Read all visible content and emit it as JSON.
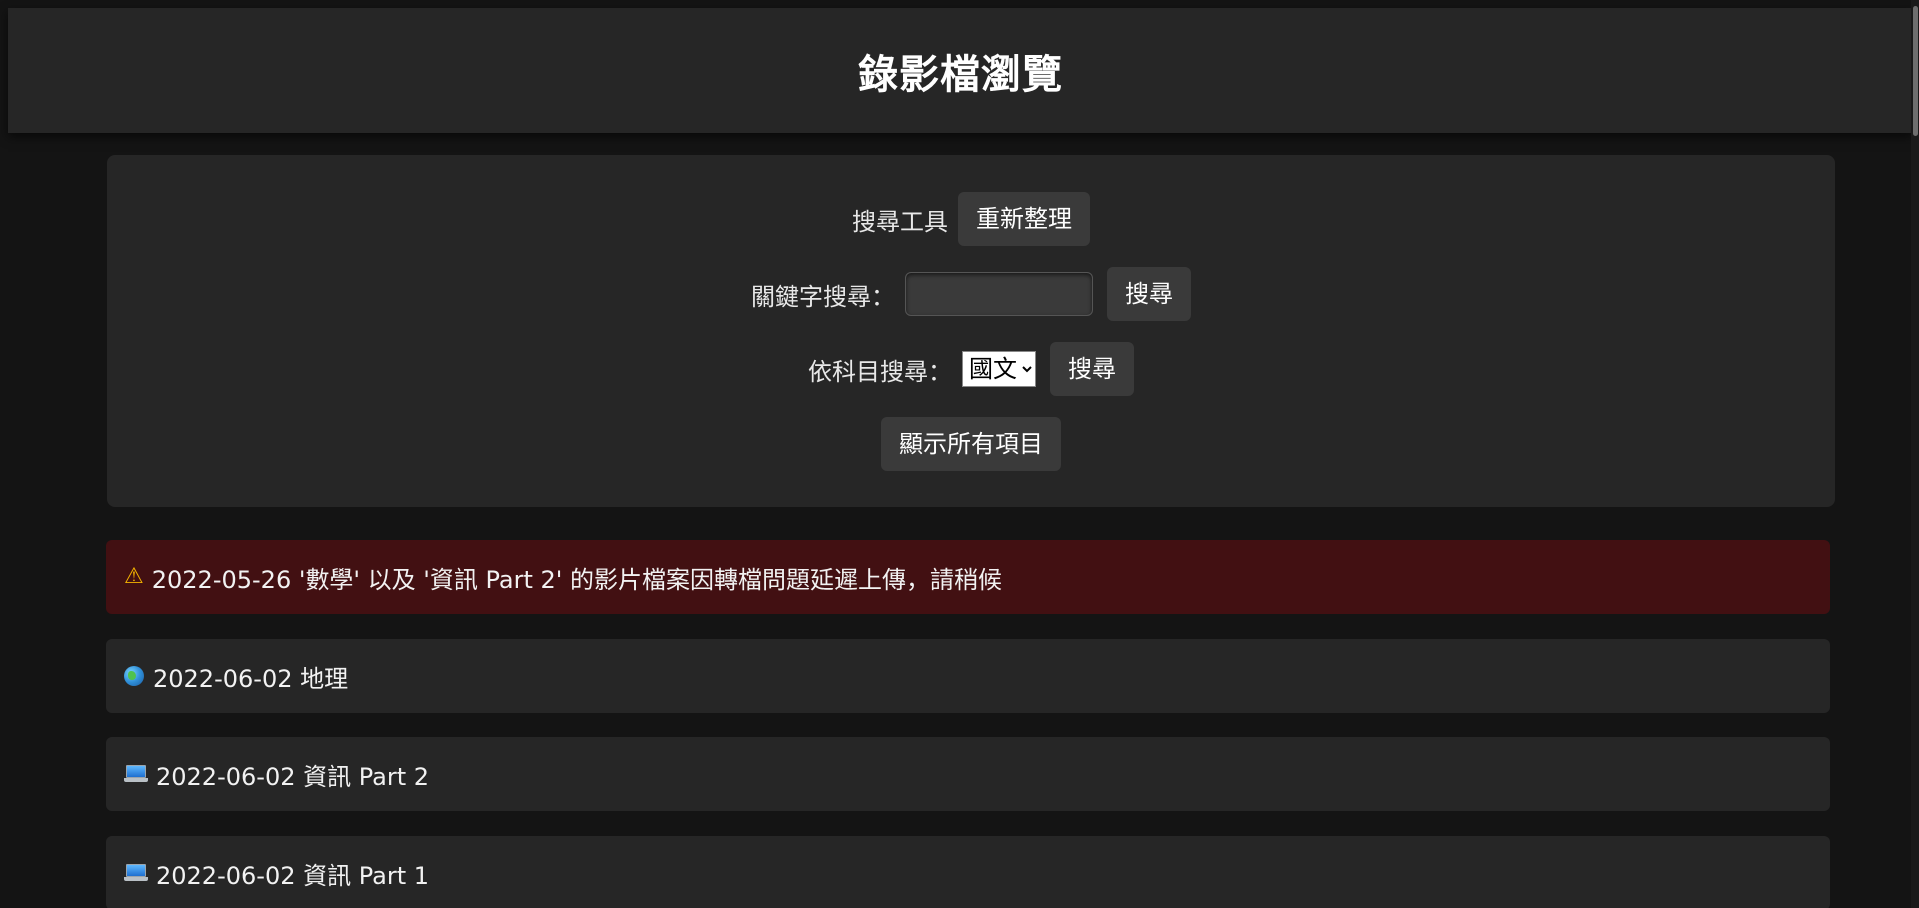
{
  "header": {
    "title": "錄影檔瀏覽"
  },
  "search": {
    "tools_label": "搜尋工具",
    "refresh_button": "重新整理",
    "keyword_label": "關鍵字搜尋：",
    "keyword_value": "",
    "keyword_button": "搜尋",
    "subject_label": "依科目搜尋：",
    "subject_selected": "國文",
    "subject_button": "搜尋",
    "show_all_button": "顯示所有項目"
  },
  "notice": {
    "icon": "warning-icon",
    "text": "2022-05-26 '數學' 以及 '資訊 Part 2' 的影片檔案因轉檔問題延遲上傳，請稍候",
    "background": "#421012"
  },
  "recordings": [
    {
      "icon": "globe-icon",
      "label": "2022-06-02 地理"
    },
    {
      "icon": "laptop-icon",
      "label": "2022-06-02 資訊 Part 2"
    },
    {
      "icon": "laptop-icon",
      "label": "2022-06-02 資訊 Part 1"
    }
  ],
  "colors": {
    "page_bg": "#141414",
    "panel_bg": "#262626",
    "button_bg": "#3a3a3a",
    "notice_bg": "#421012"
  }
}
